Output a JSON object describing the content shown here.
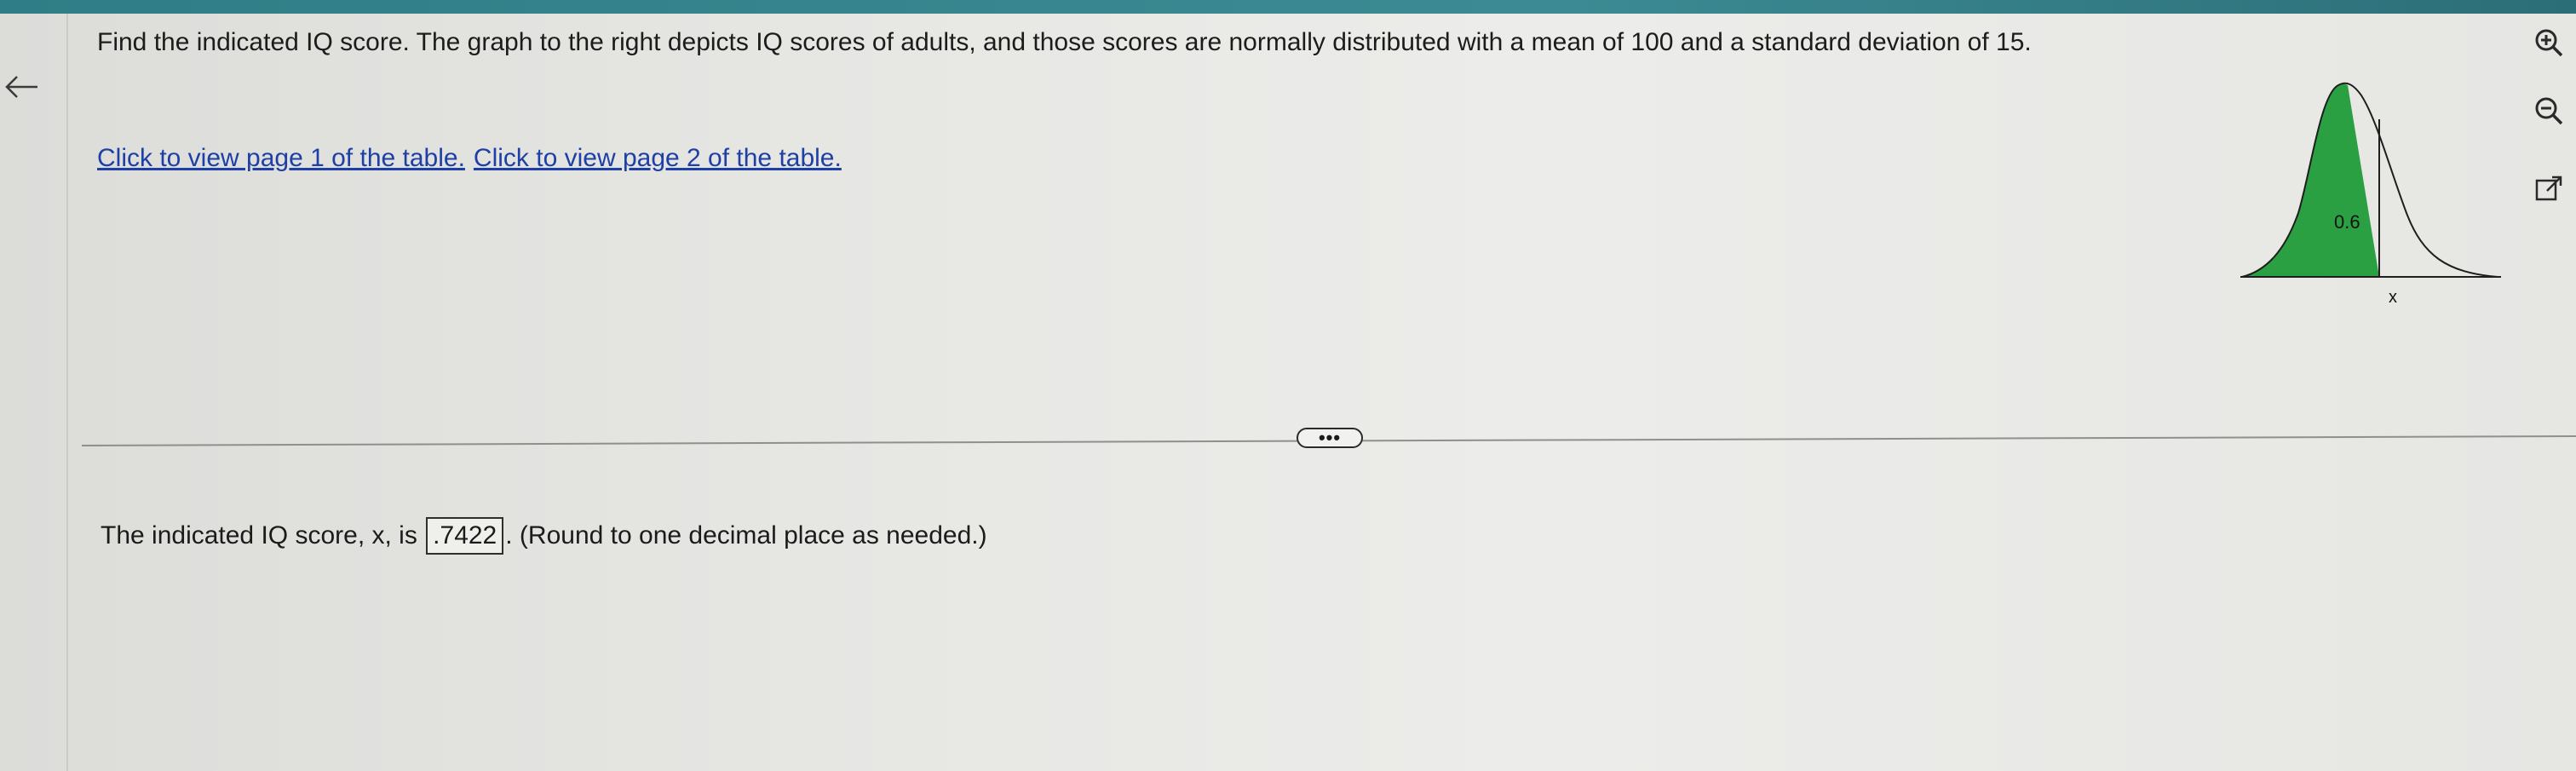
{
  "question": {
    "text": "Find the indicated IQ score. The graph to the right depicts IQ scores of adults, and those scores are normally distributed with a mean of 100 and a standard deviation of 15."
  },
  "links": {
    "page1": "Click to view page 1 of the table.",
    "page2": "Click to view page 2 of the table."
  },
  "graph": {
    "area_label": "0.6",
    "x_label": "x",
    "shaded_area": 0.6,
    "fill_color": "#2aa043"
  },
  "more_button": {
    "label": "•••"
  },
  "answer": {
    "prefix": "The indicated IQ score, x, is",
    "value": ".7422",
    "suffix": ". (Round to one decimal place as needed.)"
  },
  "icons": {
    "back": "arrow-left-icon",
    "zoom_in": "zoom-in-icon",
    "zoom_out": "zoom-out-icon",
    "popout": "external-link-icon"
  },
  "colors": {
    "top_bar": "#2f7d86",
    "link": "#1d3fa6",
    "curve_fill": "#2aa043"
  }
}
